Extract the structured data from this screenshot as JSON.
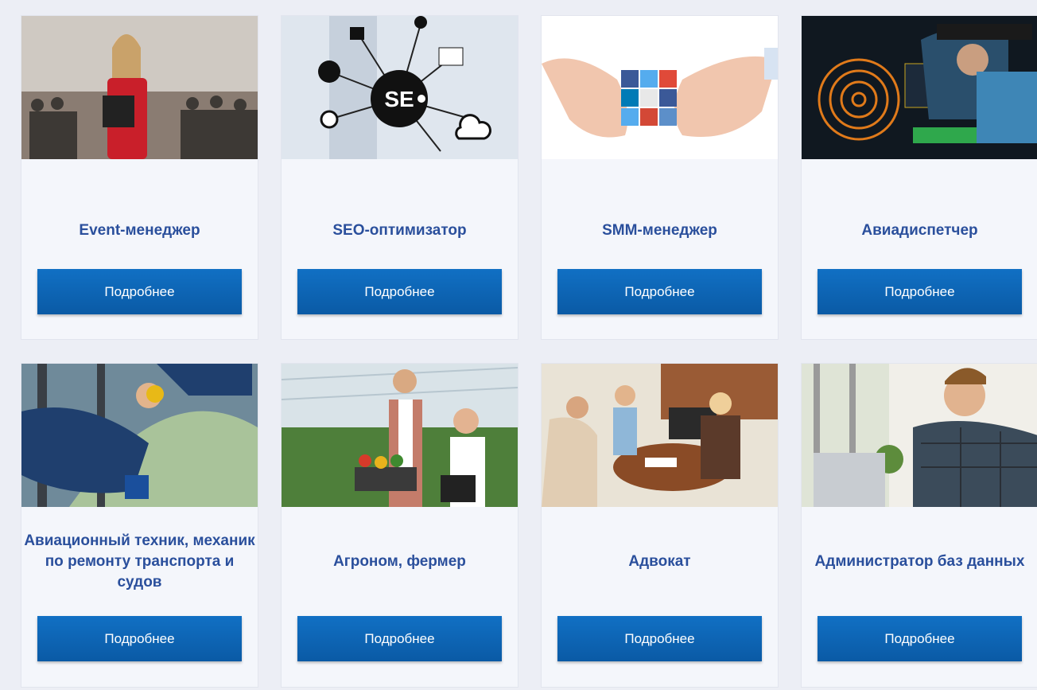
{
  "cards": [
    {
      "title": "Event-менеджер",
      "button": "Подробнее"
    },
    {
      "title": "SEO-оптимизатор",
      "button": "Подробнее",
      "photo_text": "SE"
    },
    {
      "title": "SMM-менеджер",
      "button": "Подробнее"
    },
    {
      "title": "Авиадиспетчер",
      "button": "Подробнее"
    },
    {
      "title": "Авиационный техник, механик по ремонту транспорта и судов",
      "button": "Подробнее"
    },
    {
      "title": "Агроном, фермер",
      "button": "Подробнее"
    },
    {
      "title": "Адвокат",
      "button": "Подробнее"
    },
    {
      "title": "Администратор баз данных",
      "button": "Подробнее"
    }
  ],
  "colors": {
    "title": "#2a4f9c",
    "button": "#0a63b3",
    "card_bg": "#f4f6fb",
    "page_bg": "#eceef5"
  }
}
